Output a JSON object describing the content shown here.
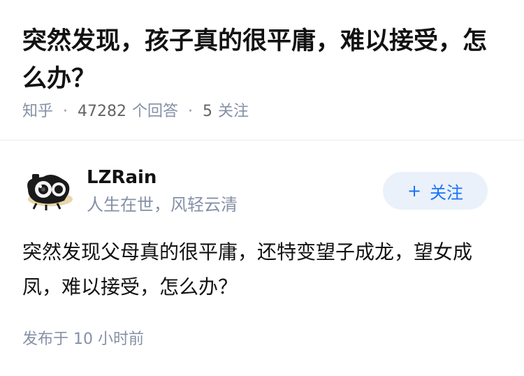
{
  "question": {
    "title": "突然发现，孩子真的很平庸，难以接受，怎么办？",
    "source": "知乎",
    "answers_count": "47282",
    "answers_label": "个回答",
    "followers_count": "5",
    "followers_label": "关注"
  },
  "answer": {
    "author": {
      "name": "LZRain",
      "bio": "人生在世，风轻云清",
      "avatar_icon": "camera-cartoon-avatar"
    },
    "follow_button": {
      "icon": "plus-icon",
      "symbol": "+",
      "label": "关注"
    },
    "content": "突然发现父母真的很平庸，还特变望子成龙，望女成凤，难以接受，怎么办？",
    "published_label": "发布于",
    "published_time": "10 小时前"
  },
  "colors": {
    "title": "#121212",
    "meta": "#8590a6",
    "accent": "#1772f6",
    "button_bg": "#eaf1fa"
  }
}
